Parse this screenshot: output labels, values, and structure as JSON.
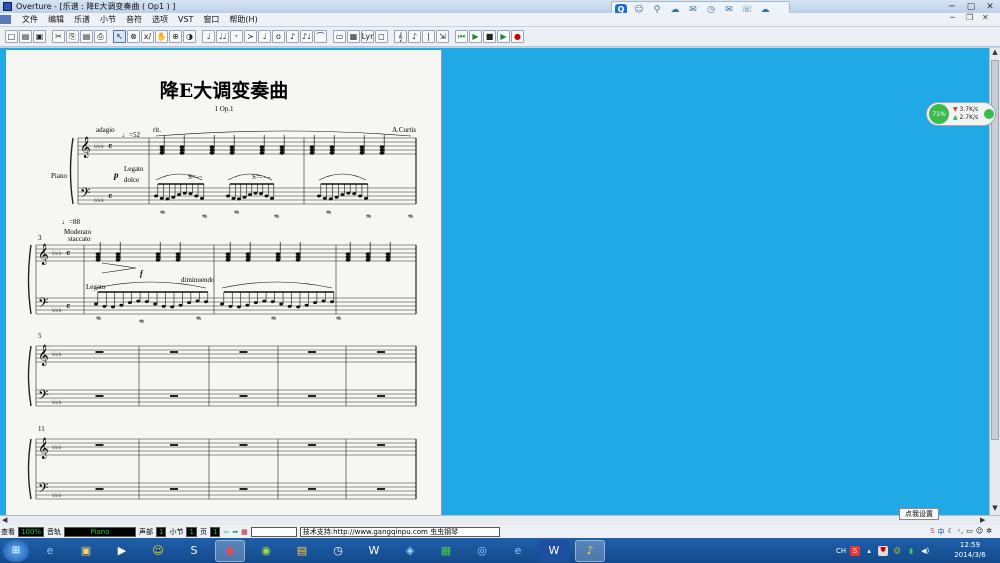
{
  "window": {
    "title": "Overture - [乐谱 : 降E大调变奏曲 ( Op1 ) ]"
  },
  "qq_toolbar": {
    "icons": [
      "qq-icon",
      "user-icon",
      "search-icon",
      "cloud-icon",
      "mail-icon",
      "clock-icon",
      "message-icon",
      "phone-icon",
      "chat-icon"
    ]
  },
  "menu": {
    "items": [
      "文件",
      "编辑",
      "乐谱",
      "小节",
      "音符",
      "选项",
      "VST",
      "窗口",
      "帮助(H)"
    ]
  },
  "toolbar": {
    "buttons": [
      "□",
      "▤",
      "▣",
      "✂",
      "⎘",
      "▤",
      "⎙",
      "↖",
      "⊗",
      "x/",
      "✋",
      "⊕",
      "◑",
      "♩",
      "♩♩",
      "𝄾",
      "≻",
      "♩",
      "o",
      "♪",
      "♪♩",
      "⌒",
      "▭",
      "▦",
      "Lyr",
      "◻",
      "𝄞",
      "♪",
      "|",
      "⇲",
      "⏮",
      "▶",
      "■",
      "▶",
      "●"
    ],
    "selected_index": 7
  },
  "score": {
    "title": "降E大调变奏曲",
    "subtitle": "1 Op.1",
    "composer": "A.Curtis",
    "instrument": "Piano",
    "sys1": {
      "tempo_word": "adagio",
      "tempo_mark": "♩=52",
      "rit": "rit.",
      "dyn": "p",
      "expr1": "Legato",
      "expr2": "dolce",
      "pedal1": "S=-¬",
      "pedal2": "S=- - -"
    },
    "sys2": {
      "tempo_mark": "♩=88",
      "tempo_word": "Moderato",
      "tempo_word2": "staccato",
      "measure_no": "3",
      "expr": "Legato",
      "dim": "diminuendo",
      "dyn": "f"
    },
    "sys3": {
      "measure_no": "5"
    },
    "sys4": {
      "measure_no": "11"
    }
  },
  "net_widget": {
    "percent": "71%",
    "up_rate": "3.7K/s",
    "down_rate": "2.7K/s"
  },
  "statusbar": {
    "view_label": "查看",
    "zoom": "100%",
    "track_label": "音轨",
    "track": "Piano",
    "voice_label": "声部",
    "voice": "1",
    "measure_label": "小节",
    "measure": "1",
    "page_label": "页",
    "page": "1",
    "support": "技术支持:http://www.gangqinpu.com 虫虫钢琴"
  },
  "tooltip": {
    "text": "点我设置"
  },
  "taskbar": {
    "apps": [
      "ie-icon",
      "explorer-icon",
      "media-icon",
      "qq-icon",
      "sogou-icon",
      "chrome-icon",
      "media-center-icon",
      "folder-icon",
      "player-icon",
      "wps-icon",
      "keyboard-icon",
      "calc-icon",
      "qqbrowser-icon",
      "ie2-icon",
      "word-icon",
      "overture-icon"
    ]
  },
  "tray": {
    "lang": "CH",
    "ime": "中"
  },
  "clock": {
    "time": "12:59",
    "date": "2014/3/6"
  }
}
